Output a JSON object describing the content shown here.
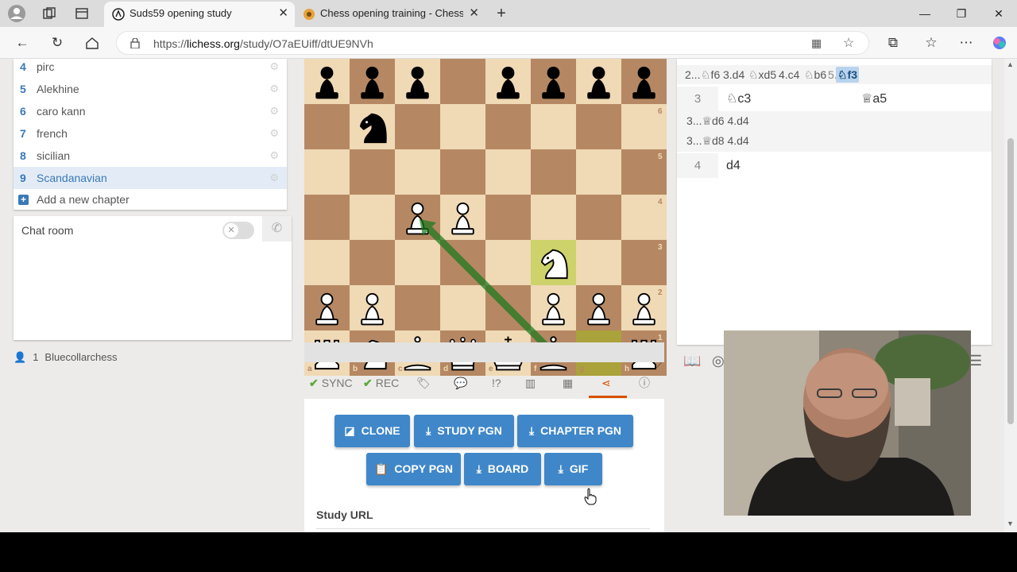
{
  "browser": {
    "tabs": [
      {
        "title": "Suds59 opening study",
        "active": true
      },
      {
        "title": "Chess opening training - Chess Te",
        "active": false
      }
    ],
    "url_prefix": "https://",
    "url_domain": "lichess.org",
    "url_path": "/study/O7aEUiff/dtUE9NVh"
  },
  "chapters": [
    {
      "num": "4",
      "name": "pirc"
    },
    {
      "num": "5",
      "name": "Alekhine"
    },
    {
      "num": "6",
      "name": "caro kann"
    },
    {
      "num": "7",
      "name": "french"
    },
    {
      "num": "8",
      "name": "sicilian"
    },
    {
      "num": "9",
      "name": "Scandanavian"
    }
  ],
  "add_chapter_label": "Add a new chapter",
  "chat": {
    "title": "Chat room"
  },
  "members": {
    "count": "1",
    "name": "Bluecollarchess"
  },
  "board": {
    "ranks": [
      "6",
      "5",
      "4",
      "3",
      "2",
      "1"
    ],
    "files": [
      "a",
      "b",
      "c",
      "d",
      "e",
      "f",
      "g",
      "h"
    ],
    "pieces": [
      {
        "sq": "a7",
        "type": "p",
        "color": "b"
      },
      {
        "sq": "b7",
        "type": "p",
        "color": "b"
      },
      {
        "sq": "c7",
        "type": "p",
        "color": "b"
      },
      {
        "sq": "e7",
        "type": "p",
        "color": "b"
      },
      {
        "sq": "f7",
        "type": "p",
        "color": "b"
      },
      {
        "sq": "g7",
        "type": "p",
        "color": "b"
      },
      {
        "sq": "h7",
        "type": "p",
        "color": "b"
      },
      {
        "sq": "b6",
        "type": "n",
        "color": "b"
      },
      {
        "sq": "c4",
        "type": "p",
        "color": "w"
      },
      {
        "sq": "d4",
        "type": "p",
        "color": "w"
      },
      {
        "sq": "f3",
        "type": "n",
        "color": "w"
      },
      {
        "sq": "a2",
        "type": "p",
        "color": "w"
      },
      {
        "sq": "b2",
        "type": "p",
        "color": "w"
      },
      {
        "sq": "f2",
        "type": "p",
        "color": "w"
      },
      {
        "sq": "g2",
        "type": "p",
        "color": "w"
      },
      {
        "sq": "h2",
        "type": "p",
        "color": "w"
      },
      {
        "sq": "a1",
        "type": "r",
        "color": "w"
      },
      {
        "sq": "b1",
        "type": "n",
        "color": "w"
      },
      {
        "sq": "c1",
        "type": "b",
        "color": "w"
      },
      {
        "sq": "d1",
        "type": "q",
        "color": "w"
      },
      {
        "sq": "e1",
        "type": "k",
        "color": "w"
      },
      {
        "sq": "f1",
        "type": "b",
        "color": "w"
      },
      {
        "sq": "h1",
        "type": "r",
        "color": "w"
      }
    ],
    "highlights": [
      "f3",
      "g1"
    ],
    "arrow": {
      "from": "f1",
      "to": "c4",
      "color": "#15781b"
    }
  },
  "tools": {
    "sync": "SYNC",
    "rec": "REC"
  },
  "share_buttons": {
    "clone": "CLONE",
    "study_pgn": "STUDY PGN",
    "chapter_pgn": "CHAPTER PGN",
    "copy_pgn": "COPY PGN",
    "board": "BOARD",
    "gif": "GIF"
  },
  "study_url_label": "Study URL",
  "moves": {
    "variation_top": [
      "2...",
      "♘f6",
      "3.d4",
      "♘xd5",
      "4.c4",
      "♘b6",
      "5.",
      "♘f3"
    ],
    "row3": {
      "idx": "3",
      "white": "♘c3",
      "black": "♕a5"
    },
    "var_a": "3...♕d6 4.d4",
    "var_b": "3...♕d8 4.d4",
    "row4": {
      "idx": "4",
      "white": "d4"
    }
  },
  "colors": {
    "accent": "#3f87c9",
    "active_tab": "#d85000",
    "light_sq": "#f0d9b5",
    "dark_sq": "#b58863"
  }
}
